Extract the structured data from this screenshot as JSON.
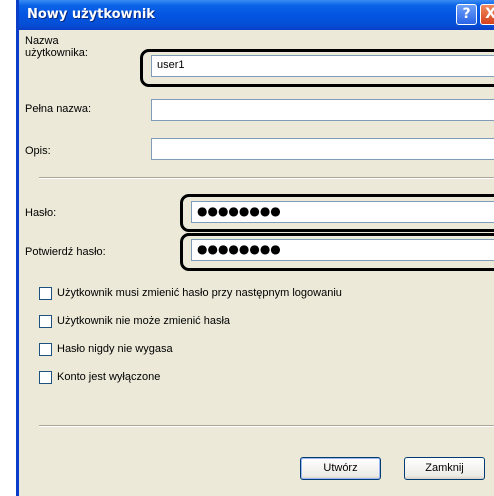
{
  "window": {
    "title": "Nowy użytkownik",
    "help_glyph": "?",
    "close_glyph": "X"
  },
  "form": {
    "username_label": "Nazwa użytkownika:",
    "username_value": "user1",
    "fullname_label": "Pełna nazwa:",
    "fullname_value": "",
    "description_label": "Opis:",
    "description_value": "",
    "password_label": "Hasło:",
    "password_value": "●●●●●●●●",
    "confirm_label": "Potwierdź hasło:",
    "confirm_value": "●●●●●●●●"
  },
  "options": [
    {
      "label": "Użytkownik musi zmienić hasło przy następnym logowaniu",
      "checked": false
    },
    {
      "label": "Użytkownik nie może zmienić hasła",
      "checked": false
    },
    {
      "label": "Hasło nigdy nie wygasa",
      "checked": false
    },
    {
      "label": "Konto jest wyłączone",
      "checked": false
    }
  ],
  "buttons": {
    "create": "Utwórz",
    "close": "Zamknij"
  },
  "colors": {
    "titlebar": "#0454e3",
    "dialog_bg": "#ece9d8",
    "highlight": "#000000"
  }
}
